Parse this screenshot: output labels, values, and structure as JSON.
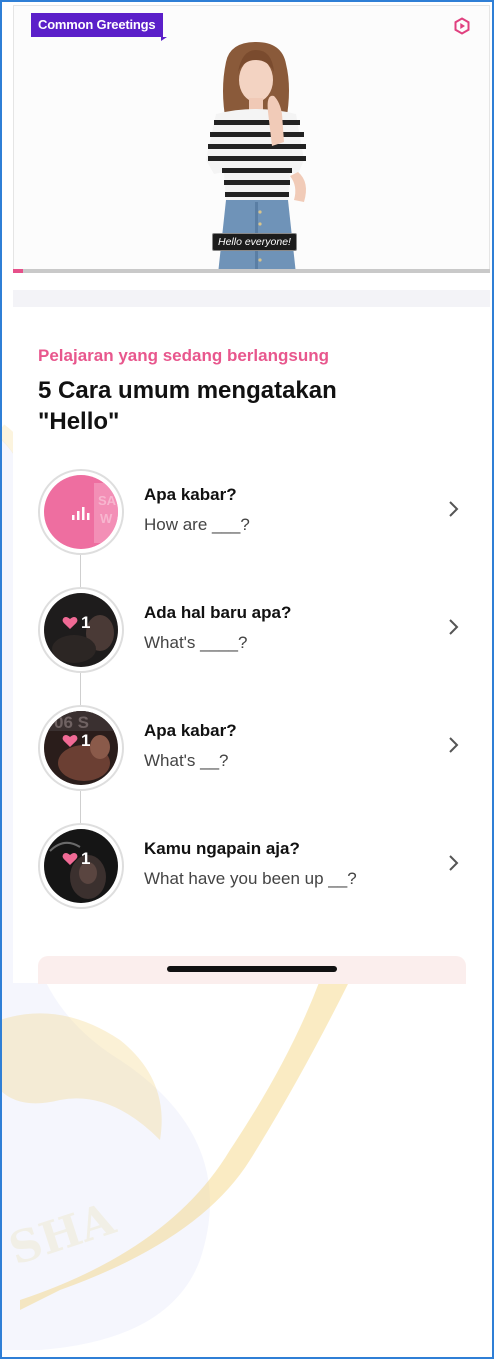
{
  "video": {
    "tag_label": "Common Greetings",
    "caption": "Hello everyone!",
    "progress": 0.02,
    "settings_icon": "hexagon-play-icon"
  },
  "lesson": {
    "subtitle": "Pelajaran yang sedang berlangsung",
    "title": "5 Cara umum mengatakan \"Hello\"",
    "items": [
      {
        "title": "Apa kabar?",
        "subtitle": "How are ___?",
        "likes": "",
        "thumb_icon": "audio-bars-icon"
      },
      {
        "title": "Ada hal baru apa?",
        "subtitle": "What's ____?",
        "likes": "1",
        "thumb_icon": "heart-icon"
      },
      {
        "title": "Apa kabar?",
        "subtitle": "What's __?",
        "likes": "1",
        "thumb_icon": "heart-icon"
      },
      {
        "title": "Kamu ngapain aja?",
        "subtitle": "What have you been up __?",
        "likes": "1",
        "thumb_icon": "heart-icon"
      }
    ]
  },
  "colors": {
    "accent_pink": "#e8578d",
    "tag_purple": "#5b1fc9",
    "frame_blue": "#2f7fd6"
  }
}
